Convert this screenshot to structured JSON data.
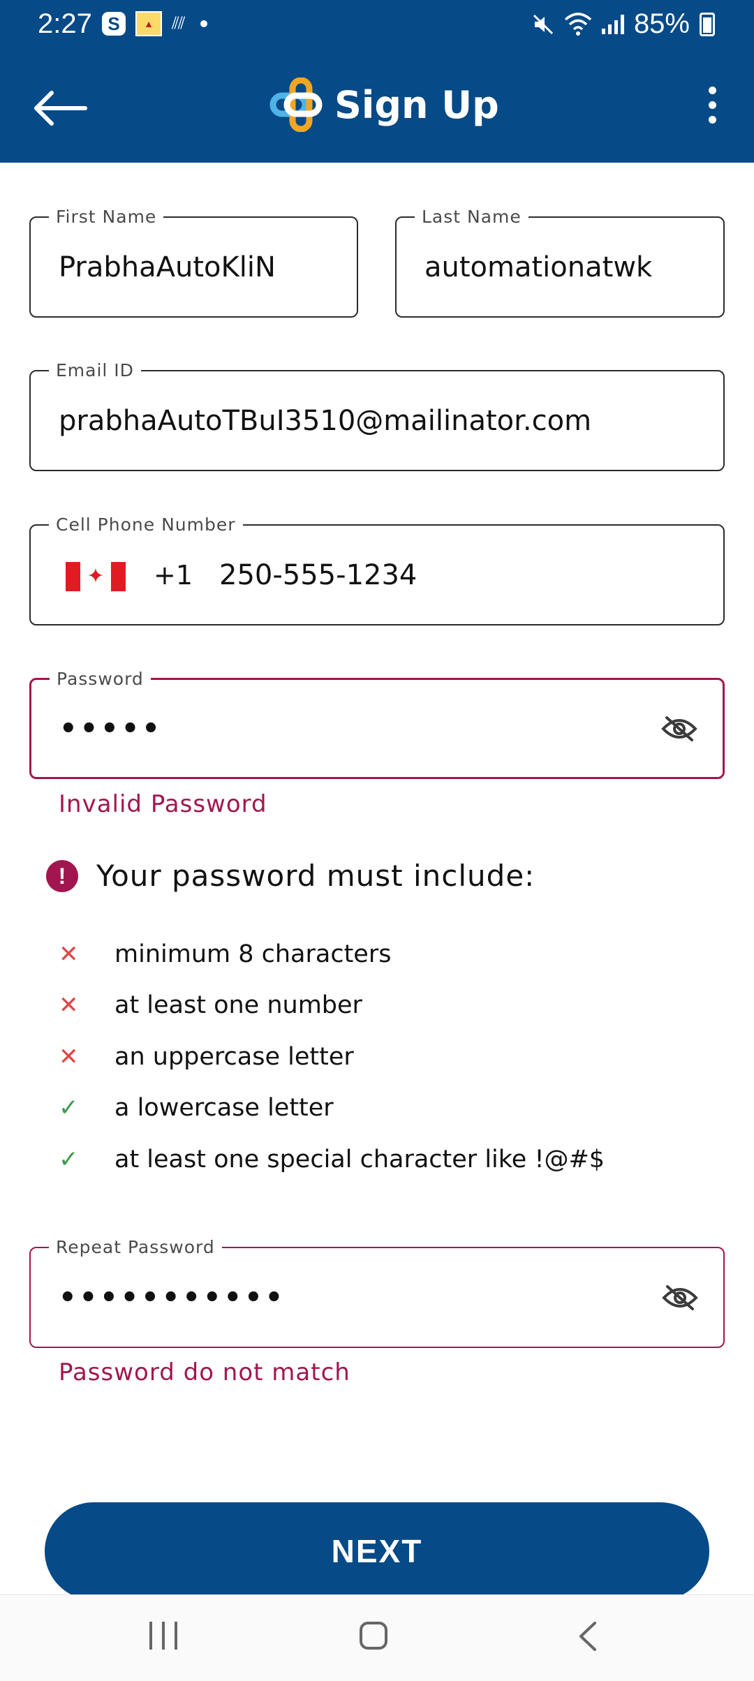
{
  "status_bar": {
    "time": "2:27",
    "battery": "85%",
    "icons": [
      "s-app-icon",
      "app-icon",
      "signal-misc-icon",
      "dot-icon",
      "mute-icon",
      "wifi-icon",
      "cell-signal-icon",
      "battery-charging-icon"
    ]
  },
  "app_bar": {
    "title": "Sign Up",
    "back_icon": "arrow-left-icon",
    "menu_icon": "more-vertical-icon"
  },
  "form": {
    "first_name": {
      "label": "First Name",
      "value": "PrabhaAutoKliN"
    },
    "last_name": {
      "label": "Last Name",
      "value": "automationatwk"
    },
    "email": {
      "label": "Email ID",
      "value": "prabhaAutoTBuI3510@mailinator.com"
    },
    "phone": {
      "label": "Cell Phone Number",
      "country_code": "+1",
      "value": "250-555-1234",
      "flag": "canada-flag"
    },
    "password": {
      "label": "Password",
      "value": "•••••",
      "error": "Invalid Password"
    },
    "repeat_password": {
      "label": "Repeat Password",
      "value": "•••••••••••",
      "error": "Password do not match"
    }
  },
  "requirements": {
    "title": "Your password must include:",
    "items": [
      {
        "text": "minimum 8 characters",
        "met": false,
        "mark": "✕"
      },
      {
        "text": "at least one number",
        "met": false,
        "mark": "✕"
      },
      {
        "text": "an uppercase letter",
        "met": false,
        "mark": "✕"
      },
      {
        "text": "a lowercase letter",
        "met": true,
        "mark": "✓"
      },
      {
        "text": "at least one special character like !@#$",
        "met": true,
        "mark": "✓"
      }
    ]
  },
  "actions": {
    "next_label": "NEXT"
  },
  "colors": {
    "primary": "#064a87",
    "error": "#a2164f",
    "fail": "#e04646",
    "pass": "#3c9a4a",
    "logo_blue": "#4fb3e8",
    "logo_orange": "#f4a623"
  }
}
